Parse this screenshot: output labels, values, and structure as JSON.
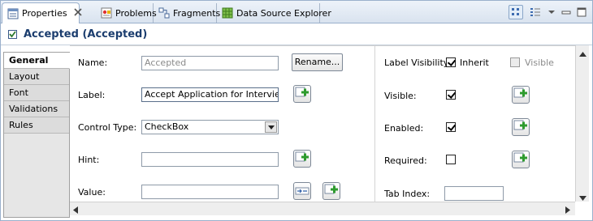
{
  "tabs": [
    {
      "label": "Properties",
      "icon": "properties-icon",
      "active": true
    },
    {
      "label": "Problems",
      "icon": "problems-icon",
      "active": false
    },
    {
      "label": "Fragments",
      "icon": "fragments-icon",
      "active": false
    },
    {
      "label": "Data Source Explorer",
      "icon": "data-source-explorer-icon",
      "active": false
    }
  ],
  "header": {
    "title": "Accepted (Accepted)",
    "icon": "checkbox-control-icon"
  },
  "left_tabs": [
    "General",
    "Layout",
    "Font",
    "Validations",
    "Rules"
  ],
  "form": {
    "name_label": "Name:",
    "name_value": "Accepted",
    "rename_button": "Rename...",
    "label_label": "Label:",
    "label_value": "Accept Application for Interview",
    "control_type_label": "Control Type:",
    "control_type_value": "CheckBox",
    "hint_label": "Hint:",
    "hint_value": "",
    "value_label": "Value:",
    "value_value": ""
  },
  "right": {
    "label_visibility_label": "Label Visibility:",
    "inherit_label": "Inherit",
    "inherit_checked": true,
    "visible_option_label": "Visible",
    "visible_option_checked": false,
    "visible_label": "Visible:",
    "visible_checked": true,
    "enabled_label": "Enabled:",
    "enabled_checked": true,
    "required_label": "Required:",
    "required_checked": false,
    "tab_index_label": "Tab Index:",
    "tab_index_value": ""
  },
  "colors": {
    "accent": "#1b3d6e",
    "tab_border": "#9ab0cc",
    "plus_green": "#2e9b2e"
  }
}
